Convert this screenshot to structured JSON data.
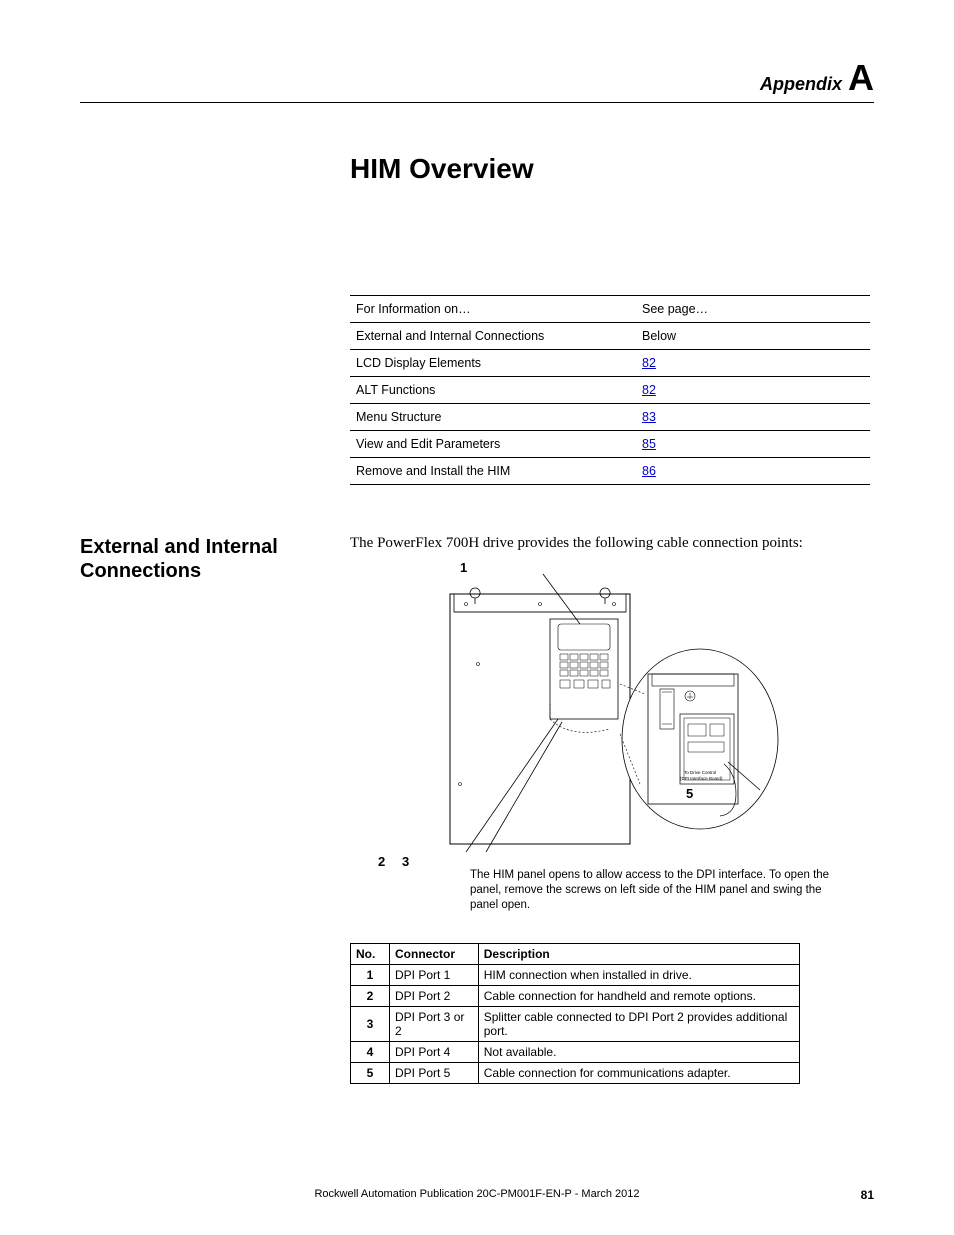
{
  "header": {
    "appendix_word": "Appendix",
    "appendix_letter": "A"
  },
  "chapter_title": "HIM Overview",
  "toc": {
    "col1": "For Information on…",
    "col2": "See page…",
    "rows": [
      {
        "topic": "External and Internal Connections",
        "page": "Below",
        "link": false
      },
      {
        "topic": "LCD Display Elements",
        "page": "82",
        "link": true
      },
      {
        "topic": "ALT Functions",
        "page": "82",
        "link": true
      },
      {
        "topic": "Menu Structure",
        "page": "83",
        "link": true
      },
      {
        "topic": "View and Edit Parameters",
        "page": "85",
        "link": true
      },
      {
        "topic": "Remove and Install the HIM",
        "page": "86",
        "link": true
      }
    ]
  },
  "section": {
    "heading": "External and Internal Connections",
    "intro": "The PowerFlex 700H drive provides the following cable connection points:"
  },
  "figure": {
    "callouts": {
      "c1": "1",
      "c2": "2",
      "c3": "3",
      "c5": "5"
    },
    "small_text_1": "To Drive Control",
    "small_text_2": "(DPI Interface Board)",
    "caption": "The HIM panel opens to allow access to the DPI interface. To open the panel, remove the screws on left side of the HIM panel and swing the panel open."
  },
  "conn_table": {
    "h_no": "No.",
    "h_conn": "Connector",
    "h_desc": "Description",
    "rows": [
      {
        "no": "1",
        "conn": "DPI Port 1",
        "desc": "HIM connection when installed in drive."
      },
      {
        "no": "2",
        "conn": "DPI Port 2",
        "desc": "Cable connection for handheld and remote options."
      },
      {
        "no": "3",
        "conn": "DPI Port 3 or 2",
        "desc": "Splitter cable connected to DPI Port 2 provides additional port."
      },
      {
        "no": "4",
        "conn": "DPI Port 4",
        "desc": "Not available."
      },
      {
        "no": "5",
        "conn": "DPI Port 5",
        "desc": "Cable connection for communications adapter."
      }
    ]
  },
  "footer": {
    "publication": "Rockwell Automation Publication 20C-PM001F-EN-P - March 2012",
    "page_number": "81"
  }
}
